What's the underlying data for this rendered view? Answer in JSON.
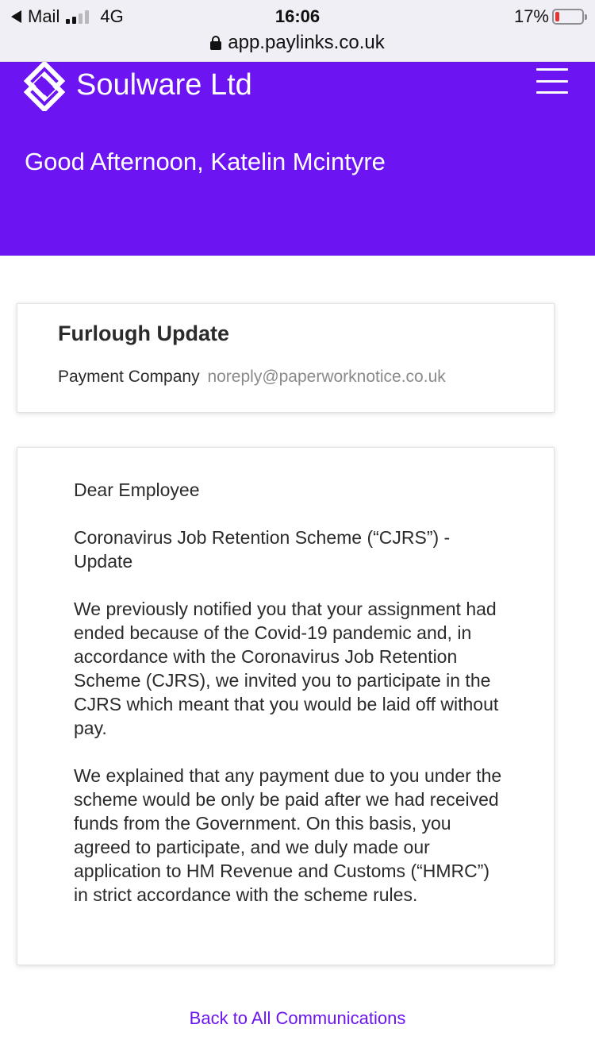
{
  "status_bar": {
    "back_app": "Mail",
    "network": "4G",
    "time": "16:06",
    "battery_percent": "17%",
    "battery_level": 0.17,
    "battery_color": "#e3342f",
    "url": "app.paylinks.co.uk"
  },
  "header": {
    "brand": "Soulware Ltd",
    "greeting": "Good Afternoon, Katelin Mcintyre",
    "background_color": "#6c14f2",
    "logo_icon": "diamond-s-logo-icon",
    "menu_icon": "hamburger-menu-icon"
  },
  "message_header": {
    "subject": "Furlough Update",
    "sender_name": "Payment Company",
    "sender_email": "noreply@paperworknotice.co.uk"
  },
  "message_body": {
    "salutation": "Dear Employee",
    "title": "Coronavirus Job Retention Scheme (“CJRS”) - Update",
    "paragraph_1": "We previously notified you that your assignment had ended because of the Covid-19 pandemic and, in accordance with the Coronavirus Job Retention Scheme (CJRS), we invited you to participate in the CJRS which meant that you would be laid off without pay.",
    "paragraph_2": "We explained that any payment due to you under the scheme would be only be paid after we had received funds from the Government. On this basis, you agreed to participate, and we duly made our application to HM Revenue and Customs (“HMRC”) in strict accordance with the scheme rules."
  },
  "footer": {
    "back_link": "Back to All Communications",
    "link_color": "#6c14f2"
  }
}
